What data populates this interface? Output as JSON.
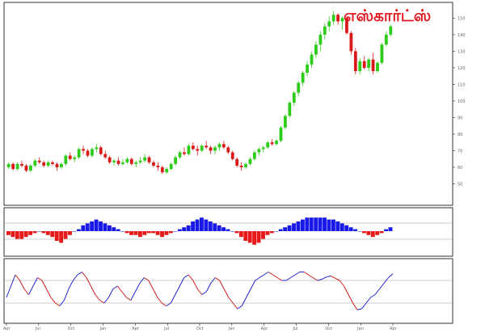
{
  "title": "எஸ்கார்ட்ஸ்",
  "colors": {
    "up": "#2ecc1a",
    "down": "#d91a1a",
    "pos_hist": "#1a1ae6",
    "neg_hist": "#e61a1a",
    "osc_blue": "#2020d0",
    "osc_red": "#d01a1a",
    "title": "#e0161d",
    "frame": "#000000",
    "grid": "#999999"
  },
  "chart_data": [
    {
      "type": "candlestick",
      "panel": "price",
      "ylim": [
        40,
        157
      ],
      "y_ticks": [
        50,
        60,
        70,
        80,
        90,
        100,
        110,
        120,
        130,
        140,
        150
      ],
      "x_labels": [
        "Apr",
        "Jul",
        "Oct",
        "Jan",
        "Apr",
        "Jul",
        "Oct",
        "Jan",
        "Apr",
        "Jul",
        "Oct",
        "Jan",
        "Apr"
      ],
      "candles": [
        [
          60,
          63,
          59,
          62
        ],
        [
          62,
          63,
          58,
          59
        ],
        [
          59,
          63,
          58,
          62
        ],
        [
          62,
          64,
          60,
          61
        ],
        [
          61,
          62,
          57,
          58
        ],
        [
          58,
          62,
          57,
          61
        ],
        [
          61,
          65,
          60,
          64
        ],
        [
          64,
          66,
          62,
          63
        ],
        [
          63,
          64,
          60,
          61
        ],
        [
          61,
          64,
          60,
          63
        ],
        [
          63,
          64,
          61,
          62
        ],
        [
          62,
          63,
          58,
          60
        ],
        [
          60,
          63,
          59,
          62
        ],
        [
          62,
          68,
          61,
          67
        ],
        [
          67,
          69,
          64,
          65
        ],
        [
          65,
          67,
          63,
          66
        ],
        [
          66,
          72,
          65,
          71
        ],
        [
          71,
          73,
          68,
          70
        ],
        [
          70,
          71,
          66,
          67
        ],
        [
          67,
          72,
          66,
          71
        ],
        [
          71,
          74,
          69,
          72
        ],
        [
          72,
          73,
          67,
          68
        ],
        [
          68,
          70,
          65,
          66
        ],
        [
          66,
          67,
          62,
          63
        ],
        [
          63,
          65,
          61,
          64
        ],
        [
          64,
          66,
          61,
          62
        ],
        [
          62,
          65,
          61,
          63
        ],
        [
          63,
          66,
          62,
          65
        ],
        [
          65,
          66,
          61,
          62
        ],
        [
          62,
          64,
          60,
          63
        ],
        [
          63,
          66,
          62,
          64
        ],
        [
          64,
          68,
          63,
          66
        ],
        [
          66,
          67,
          62,
          63
        ],
        [
          63,
          64,
          60,
          61
        ],
        [
          61,
          63,
          58,
          60
        ],
        [
          60,
          61,
          56,
          57
        ],
        [
          57,
          60,
          56,
          59
        ],
        [
          59,
          63,
          58,
          62
        ],
        [
          62,
          67,
          61,
          66
        ],
        [
          66,
          70,
          65,
          69
        ],
        [
          69,
          72,
          67,
          68
        ],
        [
          68,
          74,
          67,
          73
        ],
        [
          73,
          75,
          70,
          71
        ],
        [
          71,
          73,
          67,
          70
        ],
        [
          70,
          74,
          69,
          73
        ],
        [
          73,
          76,
          71,
          72
        ],
        [
          72,
          73,
          68,
          70
        ],
        [
          70,
          73,
          68,
          72
        ],
        [
          72,
          75,
          70,
          74
        ],
        [
          74,
          76,
          71,
          72
        ],
        [
          72,
          73,
          68,
          69
        ],
        [
          69,
          70,
          64,
          65
        ],
        [
          65,
          66,
          60,
          61
        ],
        [
          61,
          63,
          58,
          60
        ],
        [
          60,
          63,
          59,
          62
        ],
        [
          62,
          66,
          61,
          65
        ],
        [
          65,
          70,
          64,
          69
        ],
        [
          69,
          72,
          67,
          71
        ],
        [
          71,
          73,
          69,
          72
        ],
        [
          72,
          76,
          71,
          75
        ],
        [
          75,
          77,
          73,
          74
        ],
        [
          74,
          77,
          73,
          76
        ],
        [
          76,
          85,
          75,
          84
        ],
        [
          84,
          92,
          83,
          91
        ],
        [
          91,
          100,
          90,
          99
        ],
        [
          99,
          106,
          97,
          105
        ],
        [
          105,
          112,
          103,
          111
        ],
        [
          111,
          118,
          109,
          117
        ],
        [
          117,
          124,
          115,
          122
        ],
        [
          122,
          130,
          120,
          128
        ],
        [
          128,
          136,
          126,
          134
        ],
        [
          134,
          142,
          130,
          140
        ],
        [
          140,
          147,
          137,
          145
        ],
        [
          145,
          151,
          142,
          148
        ],
        [
          148,
          154,
          146,
          152
        ],
        [
          152,
          153,
          146,
          148
        ],
        [
          148,
          151,
          143,
          150
        ],
        [
          150,
          151,
          140,
          141
        ],
        [
          141,
          142,
          128,
          130
        ],
        [
          130,
          132,
          116,
          118
        ],
        [
          118,
          126,
          116,
          124
        ],
        [
          124,
          127,
          119,
          120
        ],
        [
          120,
          126,
          118,
          125
        ],
        [
          125,
          129,
          116,
          118
        ],
        [
          118,
          124,
          117,
          123
        ],
        [
          123,
          135,
          122,
          134
        ],
        [
          134,
          142,
          133,
          140
        ],
        [
          140,
          146,
          139,
          145
        ]
      ]
    },
    {
      "type": "histogram",
      "panel": "indicator",
      "ylim": [
        -10,
        10
      ],
      "values": [
        -2,
        -3,
        -4,
        -4,
        -3,
        -2,
        -1,
        0,
        -1,
        -2,
        -3,
        -5,
        -6,
        -4,
        -2,
        0,
        1,
        3,
        4,
        5,
        6,
        5,
        4,
        3,
        2,
        1,
        0,
        -1,
        -2,
        -2,
        -3,
        -2,
        -1,
        -1,
        -2,
        -3,
        -2,
        -1,
        0,
        1,
        2,
        3,
        5,
        6,
        7,
        6,
        5,
        4,
        3,
        2,
        1,
        0,
        -1,
        -3,
        -5,
        -6,
        -7,
        -6,
        -4,
        -2,
        -1,
        0,
        1,
        2,
        3,
        4,
        5,
        6,
        7,
        7,
        7,
        7,
        7,
        6,
        6,
        5,
        4,
        3,
        2,
        1,
        0,
        -1,
        -2,
        -3,
        -2,
        -1,
        1,
        2
      ]
    },
    {
      "type": "line",
      "panel": "oscillator",
      "ylim": [
        0,
        100
      ],
      "values": [
        40,
        60,
        80,
        70,
        55,
        45,
        60,
        75,
        70,
        55,
        40,
        30,
        25,
        35,
        55,
        70,
        80,
        85,
        75,
        60,
        45,
        35,
        30,
        40,
        55,
        60,
        50,
        40,
        35,
        50,
        65,
        75,
        70,
        55,
        40,
        30,
        25,
        30,
        45,
        60,
        75,
        80,
        70,
        55,
        45,
        50,
        65,
        75,
        70,
        55,
        40,
        30,
        20,
        25,
        40,
        55,
        70,
        75,
        80,
        85,
        80,
        75,
        70,
        70,
        75,
        80,
        85,
        85,
        80,
        75,
        70,
        72,
        76,
        78,
        74,
        70,
        60,
        45,
        30,
        18,
        20,
        30,
        40,
        45,
        55,
        65,
        75,
        82
      ]
    }
  ]
}
